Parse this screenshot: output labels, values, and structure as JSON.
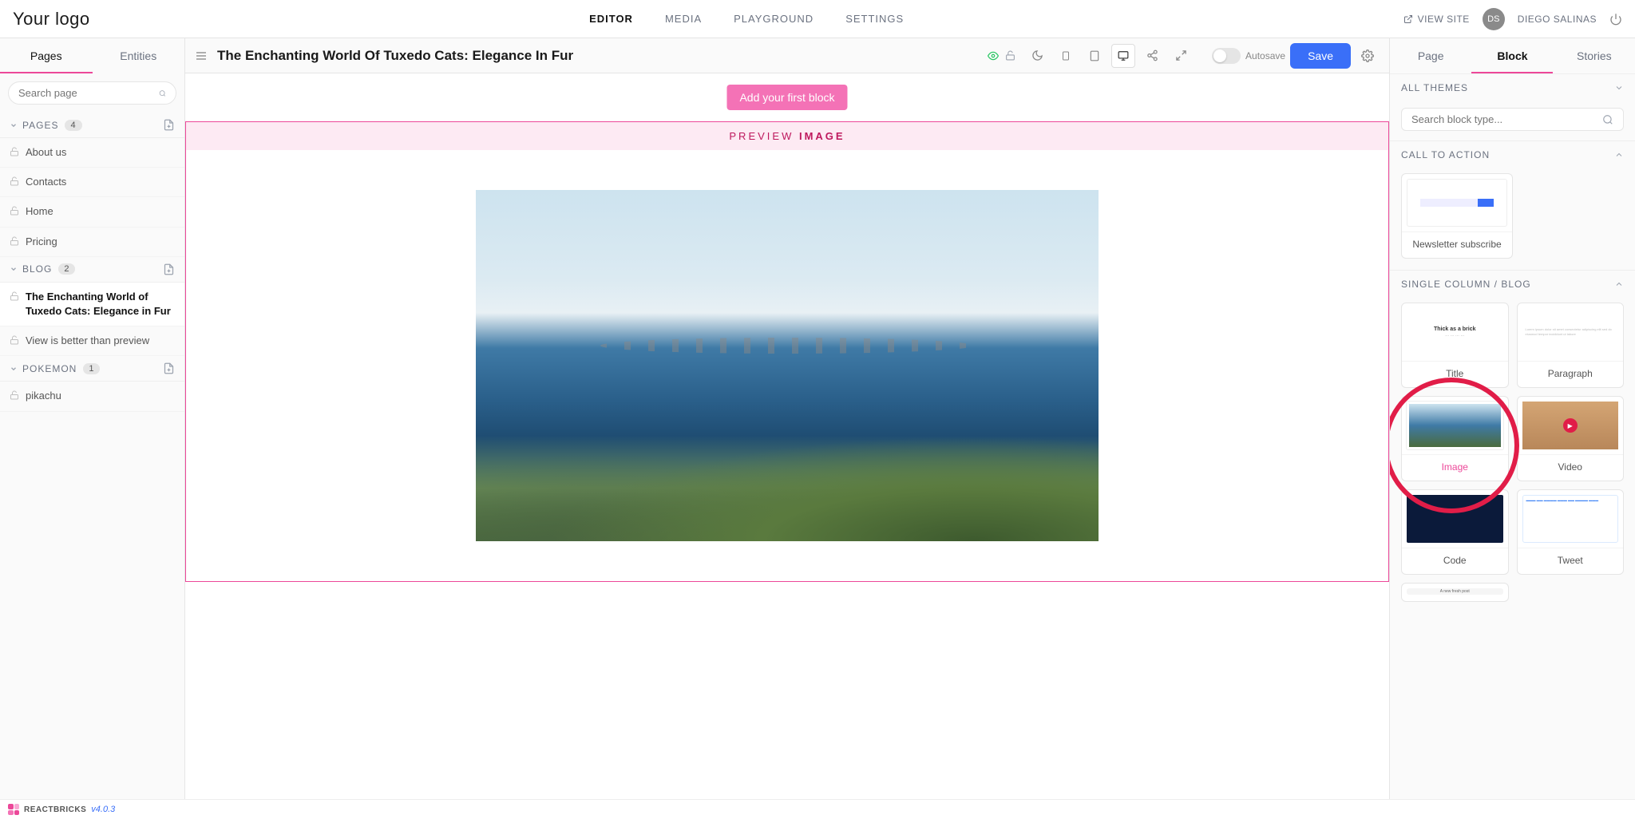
{
  "logo": "Your logo",
  "topnav": {
    "editor": "EDITOR",
    "media": "MEDIA",
    "playground": "PLAYGROUND",
    "settings": "SETTINGS"
  },
  "viewsite": "VIEW SITE",
  "user": {
    "initials": "DS",
    "name": "DIEGO SALINAS"
  },
  "lefttabs": {
    "pages": "Pages",
    "entities": "Entities"
  },
  "searchPlaceholder": "Search page",
  "groups": {
    "pages": {
      "label": "PAGES",
      "count": "4"
    },
    "blog": {
      "label": "BLOG",
      "count": "2"
    },
    "pokemon": {
      "label": "POKEMON",
      "count": "1"
    }
  },
  "pagesList": {
    "about": "About us",
    "contacts": "Contacts",
    "home": "Home",
    "pricing": "Pricing",
    "tuxedo": "The Enchanting World of Tuxedo Cats: Elegance in Fur",
    "view": "View is better than preview",
    "pikachu": "pikachu"
  },
  "pagetitle": "The Enchanting World Of Tuxedo Cats: Elegance In Fur",
  "autosave": "Autosave",
  "save": "Save",
  "ribbon": "Add your first block",
  "preview": {
    "text1": "PREVIEW ",
    "text2": "IMAGE"
  },
  "righttabs": {
    "page": "Page",
    "block": "Block",
    "stories": "Stories"
  },
  "allthemes": "ALL THEMES",
  "blockSearchPlaceholder": "Search block type...",
  "sections": {
    "cta": "CALL TO ACTION",
    "single": "SINGLE COLUMN / BLOG"
  },
  "blocks": {
    "newsletter": "Newsletter subscribe",
    "title": "Title",
    "paragraph": "Paragraph",
    "image": "Image",
    "video": "Video",
    "code": "Code",
    "tweet": "Tweet",
    "newpost": "A new fresh post"
  },
  "titleThumb": "Thick as a brick",
  "footer": {
    "brand": "REACTBRICKS",
    "version": "v4.0.3"
  }
}
